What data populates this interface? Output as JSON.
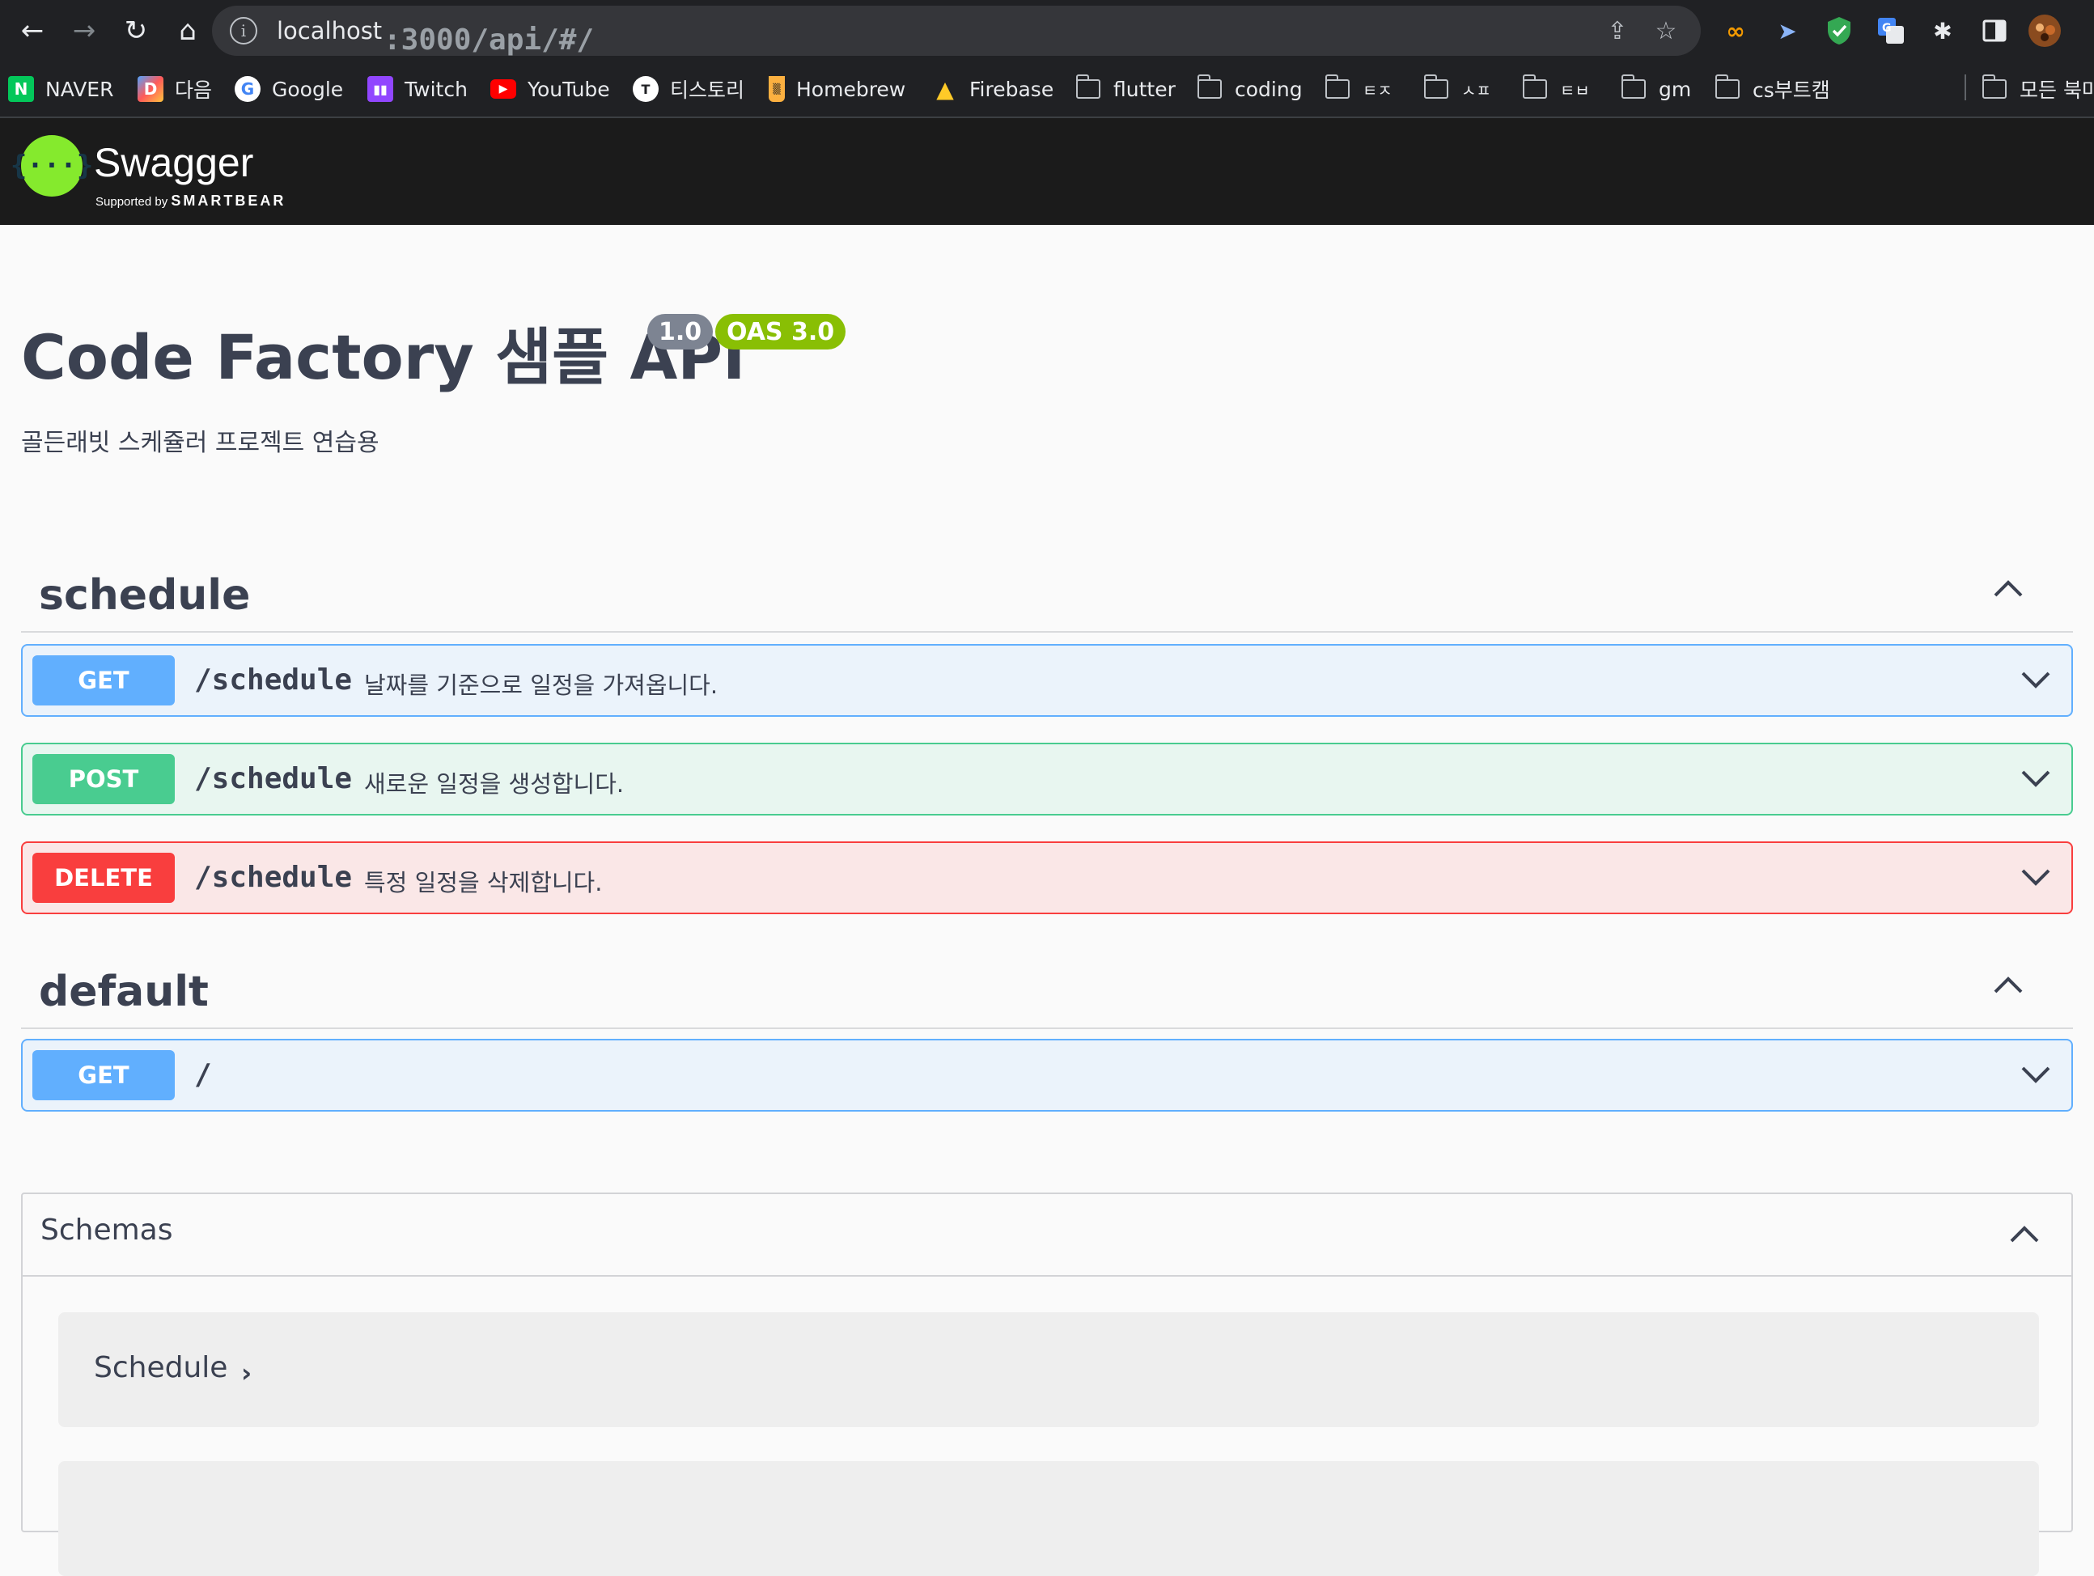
{
  "browser": {
    "url_host": "localhost",
    "url_path": ":3000/api/#/",
    "bookmarks": [
      {
        "label": "NAVER",
        "icon": "naver-icon"
      },
      {
        "label": "다음",
        "icon": "daum-icon"
      },
      {
        "label": "Google",
        "icon": "google-icon"
      },
      {
        "label": "Twitch",
        "icon": "twitch-icon"
      },
      {
        "label": "YouTube",
        "icon": "youtube-icon"
      },
      {
        "label": "티스토리",
        "icon": "tistory-icon"
      },
      {
        "label": "Homebrew",
        "icon": "homebrew-icon"
      },
      {
        "label": "Firebase",
        "icon": "firebase-icon"
      },
      {
        "label": "flutter",
        "icon": "folder-icon"
      },
      {
        "label": "coding",
        "icon": "folder-icon"
      },
      {
        "label": "ㅌㅈ",
        "icon": "folder-icon"
      },
      {
        "label": "ㅅㅍ",
        "icon": "folder-icon"
      },
      {
        "label": "ㅌㅂ",
        "icon": "folder-icon"
      },
      {
        "label": "gm",
        "icon": "folder-icon"
      },
      {
        "label": "cs부트캠",
        "icon": "folder-icon"
      }
    ],
    "other_bookmarks": "모든 북마"
  },
  "swagger": {
    "logo_text": "Swagger",
    "logo_sub": "Supported by",
    "logo_brand": "SMARTBEAR"
  },
  "info": {
    "title": "Code Factory 샘플 API",
    "version": "1.0",
    "oas": "OAS 3.0",
    "description": "골든래빗 스케쥴러 프로젝트 연습용"
  },
  "tags": [
    {
      "name": "schedule",
      "operations": [
        {
          "method": "GET",
          "path": "/schedule",
          "summary": "날짜를 기준으로 일정을 가져옵니다."
        },
        {
          "method": "POST",
          "path": "/schedule",
          "summary": "새로운 일정을 생성합니다."
        },
        {
          "method": "DELETE",
          "path": "/schedule",
          "summary": "특정 일정을 삭제합니다."
        }
      ]
    },
    {
      "name": "default",
      "operations": [
        {
          "method": "GET",
          "path": "/",
          "summary": ""
        }
      ]
    }
  ],
  "schemas": {
    "title": "Schemas",
    "models": [
      "Schedule"
    ]
  },
  "colors": {
    "get": "#61affe",
    "post": "#49cc90",
    "delete": "#f93e3e",
    "swagger_green": "#85ea2d"
  }
}
